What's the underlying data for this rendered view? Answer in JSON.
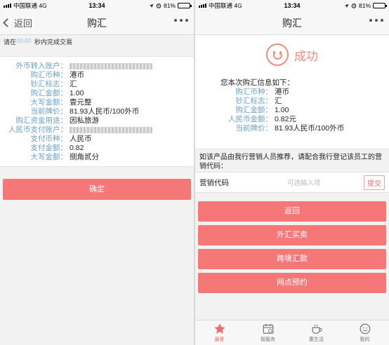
{
  "status": {
    "carrier": "中国联通",
    "network": "4G",
    "time": "13:34",
    "battery": "81%"
  },
  "left": {
    "back_label": "返回",
    "title": "购汇",
    "timer_prefix": "请在",
    "timer_value": "00:00",
    "timer_suffix": "秒内完成交易",
    "details": [
      {
        "label": "外币转入账户：",
        "value": "",
        "masked": true
      },
      {
        "label": "购汇币种：",
        "value": "港币"
      },
      {
        "label": "钞汇标志：",
        "value": "汇"
      },
      {
        "label": "购汇金额：",
        "value": "1.00"
      },
      {
        "label": "大写金额：",
        "value": "壹元整"
      },
      {
        "label": "当前牌价：",
        "value": "81.93人民币/100外币"
      },
      {
        "label": "购汇资金用途：",
        "value": "因私旅游"
      },
      {
        "label": "人民币支付账户：",
        "value": "",
        "masked": true
      },
      {
        "label": "支付币种：",
        "value": "人民币"
      },
      {
        "label": "支付金额：",
        "value": "0.82"
      },
      {
        "label": "大写金额：",
        "value": "捌角贰分"
      }
    ],
    "confirm_label": "确定"
  },
  "right": {
    "title": "购汇",
    "success_label": "成功",
    "summary_title": "您本次购汇信息如下：",
    "summary": [
      {
        "label": "购汇币种：",
        "value": "港币"
      },
      {
        "label": "钞汇标志：",
        "value": "汇"
      },
      {
        "label": "购汇金额：",
        "value": "1.00"
      },
      {
        "label": "人民币金额：",
        "value": "0.82元"
      },
      {
        "label": "当前牌价：",
        "value": "81.93人民币/100外币"
      }
    ],
    "promo_text": "如该产品由我行营销人员推荐，请配合我行登记该员工的营销代码：",
    "marketing_code_label": "营销代码",
    "marketing_code_placeholder": "可选输入项",
    "submit_label": "提交",
    "actions": [
      "返回",
      "外汇买卖",
      "跨境汇款",
      "网点预约"
    ],
    "tabs": [
      {
        "label": "最爱",
        "icon": "star-icon",
        "active": true
      },
      {
        "label": "智服务",
        "icon": "calendar-icon",
        "active": false
      },
      {
        "label": "惠生活",
        "icon": "coffee-cup-icon",
        "active": false
      },
      {
        "label": "我的",
        "icon": "smiley-icon",
        "active": false
      }
    ]
  },
  "colors": {
    "accent": "#f57777",
    "label_blue": "#6aa0c8",
    "success": "#f28b7b"
  }
}
